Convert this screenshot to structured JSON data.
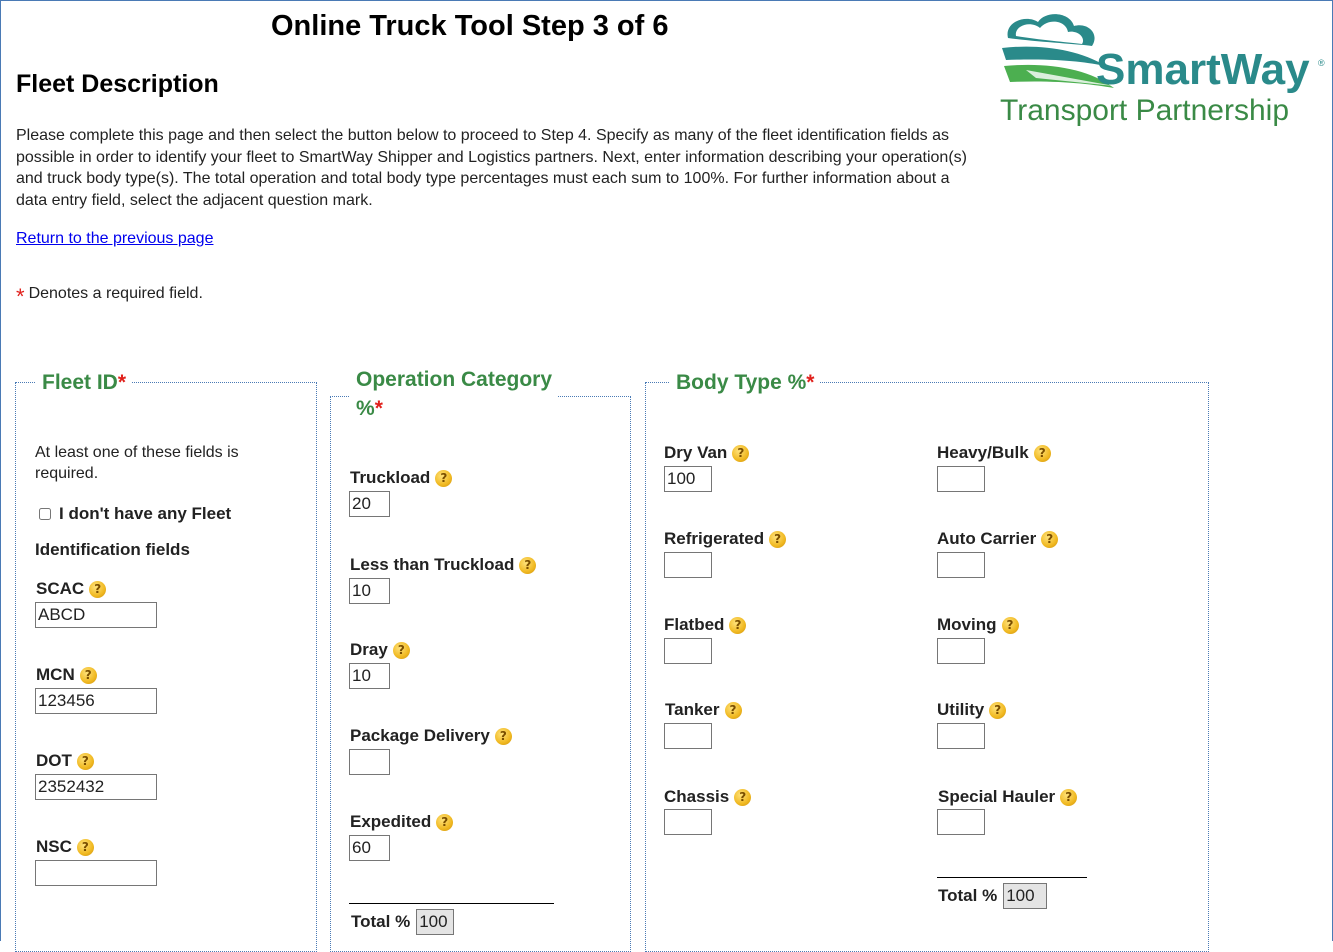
{
  "header": {
    "title": "Online Truck Tool Step 3 of 6",
    "section_title": "Fleet Description"
  },
  "logo": {
    "brand": "SmartWay",
    "registered": "®",
    "tagline": "Transport Partnership",
    "colors": {
      "green": "#3a8a46",
      "teal": "#2a8a8a",
      "leaf": "#4caf50"
    }
  },
  "intro": {
    "text": "Please complete this page and then select the button below to proceed to Step 4. Specify as many of the fleet identification fields as possible in order to identify your fleet to SmartWay Shipper and Logistics partners. Next, enter information describing your operation(s) and truck body type(s). The total operation and total body type percentages must each sum to 100%. For further information about a data entry field, select the adjacent question mark."
  },
  "links": {
    "back": "Return to the previous page"
  },
  "required_note": {
    "star": "*",
    "text": "Denotes a required field."
  },
  "help_icon": "?",
  "fleet_id": {
    "legend": "Fleet ID",
    "legend_req": "*",
    "note": "At least one of these fields is required.",
    "no_fleet_checkbox": {
      "label_line1": "I don't have any Fleet",
      "label_line2": "Identification fields",
      "checked": false
    },
    "fields": [
      {
        "label": "SCAC",
        "value": "ABCD"
      },
      {
        "label": "MCN",
        "value": "123456"
      },
      {
        "label": "DOT",
        "value": "2352432"
      },
      {
        "label": "NSC",
        "value": ""
      }
    ]
  },
  "operation": {
    "legend_line1": "Operation Category",
    "legend_line2": "%",
    "legend_req": "*",
    "fields": [
      {
        "label": "Truckload",
        "value": "20"
      },
      {
        "label": "Less than Truckload",
        "value": "10"
      },
      {
        "label": "Dray",
        "value": "10"
      },
      {
        "label": "Package Delivery",
        "value": ""
      },
      {
        "label": "Expedited",
        "value": "60"
      }
    ],
    "total_label": "Total %",
    "total_value": "100"
  },
  "body_type": {
    "legend": "Body Type %",
    "legend_req": "*",
    "left": [
      {
        "label": "Dry Van",
        "value": "100"
      },
      {
        "label": "Refrigerated",
        "value": ""
      },
      {
        "label": "Flatbed",
        "value": ""
      },
      {
        "label": "Tanker",
        "value": ""
      },
      {
        "label": "Chassis",
        "value": ""
      }
    ],
    "right": [
      {
        "label": "Heavy/Bulk",
        "value": ""
      },
      {
        "label": "Auto Carrier",
        "value": ""
      },
      {
        "label": "Moving",
        "value": ""
      },
      {
        "label": "Utility",
        "value": ""
      },
      {
        "label": "Special Hauler",
        "value": ""
      }
    ],
    "total_label": "Total %",
    "total_value": "100"
  }
}
